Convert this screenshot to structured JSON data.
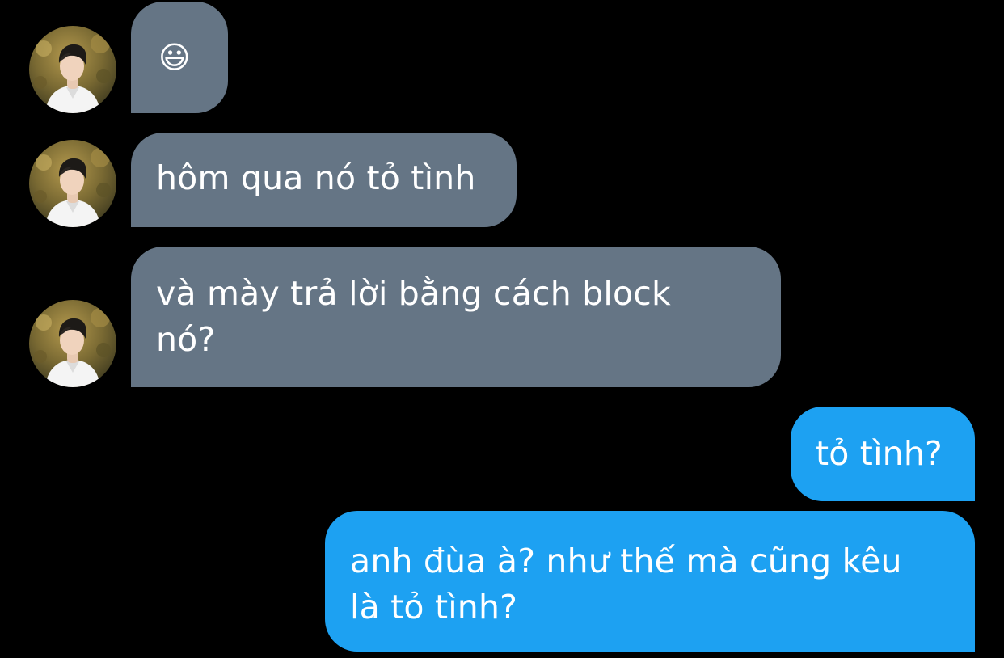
{
  "conversation": {
    "messages": [
      {
        "direction": "incoming",
        "text": "😃",
        "avatar": "contact-avatar"
      },
      {
        "direction": "incoming",
        "text": "hôm qua nó tỏ tình",
        "avatar": "contact-avatar"
      },
      {
        "direction": "incoming",
        "text": "và mày trả lời bằng cách block\nnó?",
        "avatar": "contact-avatar"
      },
      {
        "direction": "outgoing",
        "text": "tỏ tình?"
      },
      {
        "direction": "outgoing",
        "text": "anh đùa à? như thế mà cũng kêu\nlà tỏ tình?"
      }
    ]
  },
  "colors": {
    "background": "#000000",
    "incoming_bubble": "#657585",
    "outgoing_bubble": "#1da1f2",
    "text": "#ffffff"
  }
}
